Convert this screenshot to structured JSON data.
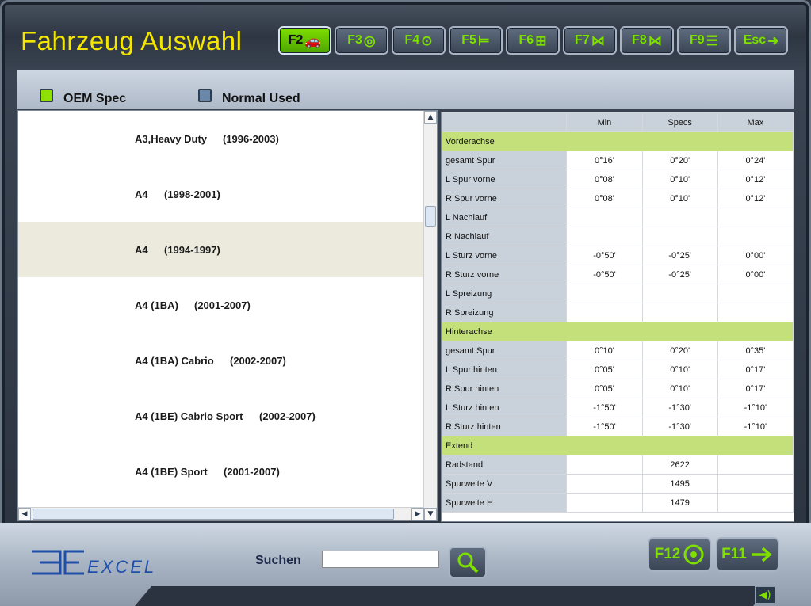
{
  "window": {
    "title": "Fahrzeug Auswahl"
  },
  "colors": {
    "accent_green": "#7fe000",
    "title_yellow": "#f5e600",
    "group_row": "#c3e07a",
    "label_cell": "#c9d2db",
    "selected_row": "#ece9dd"
  },
  "toolbar": {
    "keys": [
      {
        "label": "F2",
        "icon": "car-icon",
        "glyph": "🚗",
        "active": true
      },
      {
        "label": "F3",
        "icon": "wheel-icon",
        "glyph": "◎"
      },
      {
        "label": "F4",
        "icon": "tool-wheel-icon",
        "glyph": "⊙"
      },
      {
        "label": "F5",
        "icon": "axle-icon",
        "glyph": "⊨"
      },
      {
        "label": "F6",
        "icon": "axle-adjust-icon",
        "glyph": "⊞"
      },
      {
        "label": "F7",
        "icon": "suspension-icon",
        "glyph": "⋈"
      },
      {
        "label": "F8",
        "icon": "chassis-icon",
        "glyph": "⋈"
      },
      {
        "label": "F9",
        "icon": "list-icon",
        "glyph": "☰"
      },
      {
        "label": "Esc",
        "icon": "exit-icon",
        "glyph": "➜"
      }
    ]
  },
  "modes": {
    "oem_spec": "OEM Spec",
    "normal_used": "Normal Used"
  },
  "vehicle_list": [
    {
      "model": "A3,Heavy Duty",
      "years": "(1996-2003)"
    },
    {
      "model": "A4",
      "years": "(1998-2001)"
    },
    {
      "model": "A4",
      "years": "(1994-1997)",
      "selected": true
    },
    {
      "model": "A4 (1BA)",
      "years": "(2001-2007)"
    },
    {
      "model": "A4 (1BA) Cabrio",
      "years": "(2002-2007)"
    },
    {
      "model": "A4 (1BE) Cabrio Sport",
      "years": "(2002-2007)"
    },
    {
      "model": "A4 (1BE) Sport",
      "years": "(2001-2007)"
    }
  ],
  "spec_table": {
    "headers": [
      "",
      "Min",
      "Specs",
      "Max"
    ],
    "rows": [
      {
        "group": "Vorderachse"
      },
      {
        "label": "gesamt Spur",
        "min": "0°16'",
        "spec": "0°20'",
        "max": "0°24'"
      },
      {
        "label": "L Spur vorne",
        "min": "0°08'",
        "spec": "0°10'",
        "max": "0°12'"
      },
      {
        "label": "R Spur vorne",
        "min": "0°08'",
        "spec": "0°10'",
        "max": "0°12'"
      },
      {
        "label": "L Nachlauf",
        "min": "",
        "spec": "",
        "max": ""
      },
      {
        "label": "R Nachlauf",
        "min": "",
        "spec": "",
        "max": ""
      },
      {
        "label": "L Sturz vorne",
        "min": "-0°50'",
        "spec": "-0°25'",
        "max": "0°00'"
      },
      {
        "label": "R Sturz vorne",
        "min": "-0°50'",
        "spec": "-0°25'",
        "max": "0°00'"
      },
      {
        "label": "L Spreizung",
        "min": "",
        "spec": "",
        "max": ""
      },
      {
        "label": "R Spreizung",
        "min": "",
        "spec": "",
        "max": ""
      },
      {
        "group": "Hinterachse"
      },
      {
        "label": "gesamt Spur",
        "min": "0°10'",
        "spec": "0°20'",
        "max": "0°35'"
      },
      {
        "label": "L Spur hinten",
        "min": "0°05'",
        "spec": "0°10'",
        "max": "0°17'"
      },
      {
        "label": "R Spur hinten",
        "min": "0°05'",
        "spec": "0°10'",
        "max": "0°17'"
      },
      {
        "label": "L Sturz hinten",
        "min": "-1°50'",
        "spec": "-1°30'",
        "max": "-1°10'"
      },
      {
        "label": "R Sturz hinten",
        "min": "-1°50'",
        "spec": "-1°30'",
        "max": "-1°10'"
      },
      {
        "group": "Extend"
      },
      {
        "label": "Radstand",
        "min": "",
        "spec": "2622",
        "max": ""
      },
      {
        "label": "Spurweite V",
        "min": "",
        "spec": "1495",
        "max": ""
      },
      {
        "label": "Spurweite H",
        "min": "",
        "spec": "1479",
        "max": ""
      }
    ]
  },
  "footer": {
    "logo_text": "EXCEL",
    "search_label": "Suchen",
    "search_value": "",
    "f12_label": "F12",
    "f11_label": "F11"
  }
}
